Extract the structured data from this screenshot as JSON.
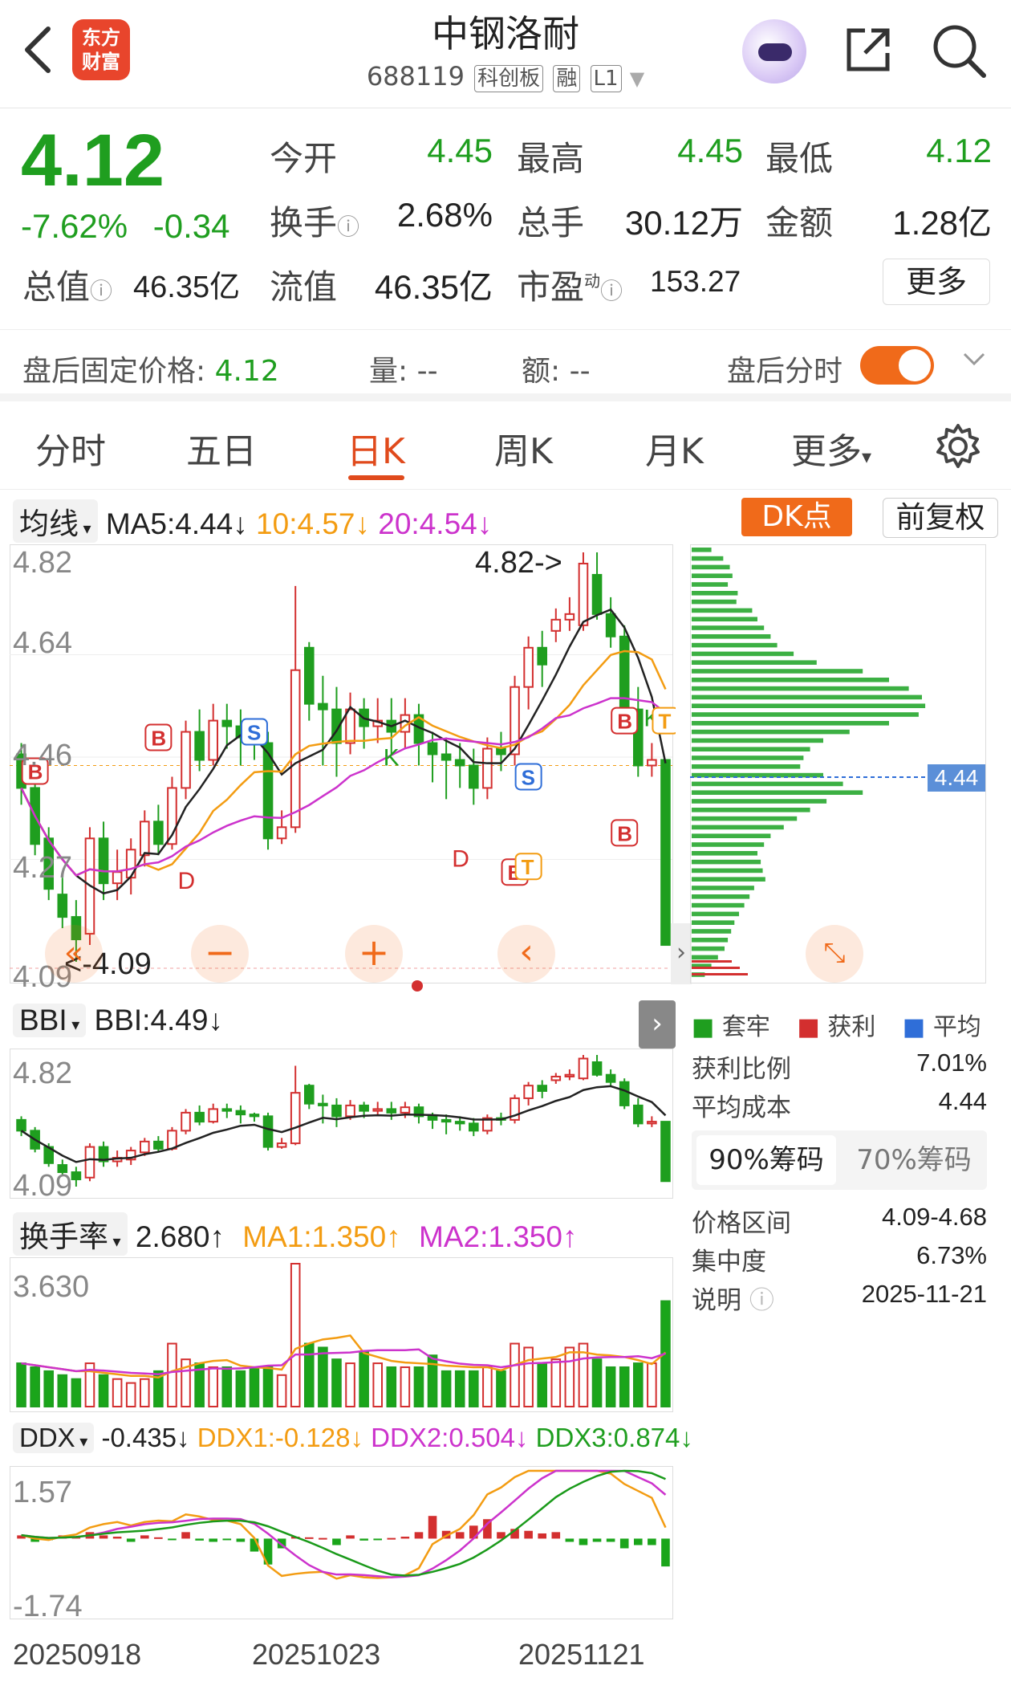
{
  "header": {
    "logo_line1": "东方",
    "logo_line2": "财富",
    "stock_name": "中钢洛耐",
    "stock_code": "688119",
    "tags": [
      "科创板",
      "融",
      "L1"
    ]
  },
  "quote": {
    "price": "4.12",
    "change_pct": "-7.62%",
    "change_abs": "-0.34",
    "open_label": "今开",
    "open": "4.45",
    "high_label": "最高",
    "high": "4.45",
    "low_label": "最低",
    "low": "4.12",
    "turnover_label": "换手",
    "turnover": "2.68%",
    "volume_label": "总手",
    "volume": "30.12万",
    "amount_label": "金额",
    "amount": "1.28亿",
    "total_mv_label": "总值",
    "total_mv": "46.35亿",
    "float_mv_label": "流值",
    "float_mv": "46.35亿",
    "pe_label": "市盈",
    "pe_sup": "动",
    "pe": "153.27",
    "more_label": "更多"
  },
  "after_hours": {
    "fixed_price_label": "盘后固定价格:",
    "fixed_price": "4.12",
    "vol_label": "量:",
    "vol": "--",
    "amt_label": "额:",
    "amt": "--",
    "intraday_label": "盘后分时",
    "toggle_on": true
  },
  "tabs": [
    "分时",
    "五日",
    "日K",
    "周K",
    "月K",
    "更多"
  ],
  "active_tab": "日K",
  "ma_row": {
    "selector": "均线",
    "ma5": "MA5:4.44↓",
    "ma10": "10:4.57↓",
    "ma20": "20:4.54↓",
    "dk_label": "DK点",
    "adj_label": "前复权"
  },
  "main_chart": {
    "y_labels": [
      "4.82",
      "4.64",
      "4.46",
      "4.27",
      "4.09"
    ],
    "max_label": "4.82->",
    "min_label": "<-4.09",
    "markers": [
      "B",
      "B",
      "S",
      "K",
      "D",
      "D",
      "B",
      "B",
      "T",
      "S",
      "B",
      "K",
      "T",
      "B"
    ]
  },
  "chip_panel": {
    "current_price": "4.44",
    "legend": [
      "套牢",
      "获利",
      "平均"
    ],
    "profit_ratio_label": "获利比例",
    "profit_ratio": "7.01%",
    "avg_cost_label": "平均成本",
    "avg_cost": "4.44",
    "tab_90": "90%筹码",
    "tab_70": "70%筹码",
    "range_label": "价格区间",
    "range": "4.09-4.68",
    "concentration_label": "集中度",
    "concentration": "6.73%",
    "note_label": "说明",
    "date": "2025-11-21"
  },
  "bbi": {
    "selector": "BBI",
    "value": "BBI:4.49↓",
    "y_labels": [
      "4.82",
      "4.09"
    ]
  },
  "turnover_ind": {
    "selector": "换手率",
    "value": "2.680↑",
    "ma1": "MA1:1.350↑",
    "ma2": "MA2:1.350↑",
    "y_label": "3.630"
  },
  "ddx": {
    "selector": "DDX",
    "value": "-0.435↓",
    "ddx1": "DDX1:-0.128↓",
    "ddx2": "DDX2:0.504↓",
    "ddx3": "DDX3:0.874↓",
    "y_labels": [
      "1.57",
      "-1.74"
    ]
  },
  "x_axis": [
    "20250918",
    "20251023",
    "20251121"
  ],
  "colors": {
    "up": "#d32f2f",
    "down": "#1f9e1f",
    "ma10": "#f39c12",
    "ma20": "#cc33cc",
    "accent": "#f06a1a"
  },
  "candles": [
    {
      "o": 4.46,
      "c": 4.4,
      "h": 4.48,
      "l": 4.37
    },
    {
      "o": 4.4,
      "c": 4.3,
      "h": 4.42,
      "l": 4.28
    },
    {
      "o": 4.31,
      "c": 4.22,
      "h": 4.33,
      "l": 4.2
    },
    {
      "o": 4.21,
      "c": 4.17,
      "h": 4.24,
      "l": 4.15
    },
    {
      "o": 4.17,
      "c": 4.13,
      "h": 4.2,
      "l": 4.09
    },
    {
      "o": 4.14,
      "c": 4.31,
      "h": 4.33,
      "l": 4.12
    },
    {
      "o": 4.31,
      "c": 4.23,
      "h": 4.34,
      "l": 4.2
    },
    {
      "o": 4.23,
      "c": 4.25,
      "h": 4.29,
      "l": 4.2
    },
    {
      "o": 4.24,
      "c": 4.29,
      "h": 4.31,
      "l": 4.21
    },
    {
      "o": 4.28,
      "c": 4.34,
      "h": 4.36,
      "l": 4.26
    },
    {
      "o": 4.34,
      "c": 4.3,
      "h": 4.37,
      "l": 4.28
    },
    {
      "o": 4.3,
      "c": 4.4,
      "h": 4.42,
      "l": 4.29
    },
    {
      "o": 4.4,
      "c": 4.5,
      "h": 4.52,
      "l": 4.38
    },
    {
      "o": 4.5,
      "c": 4.45,
      "h": 4.54,
      "l": 4.43
    },
    {
      "o": 4.45,
      "c": 4.52,
      "h": 4.55,
      "l": 4.44
    },
    {
      "o": 4.52,
      "c": 4.51,
      "h": 4.55,
      "l": 4.47
    },
    {
      "o": 4.51,
      "c": 4.49,
      "h": 4.54,
      "l": 4.44
    },
    {
      "o": 4.49,
      "c": 4.48,
      "h": 4.5,
      "l": 4.45
    },
    {
      "o": 4.48,
      "c": 4.31,
      "h": 4.5,
      "l": 4.29
    },
    {
      "o": 4.31,
      "c": 4.33,
      "h": 4.36,
      "l": 4.3
    },
    {
      "o": 4.33,
      "c": 4.61,
      "h": 4.76,
      "l": 4.32
    },
    {
      "o": 4.65,
      "c": 4.55,
      "h": 4.66,
      "l": 4.52
    },
    {
      "o": 4.55,
      "c": 4.54,
      "h": 4.6,
      "l": 4.44
    },
    {
      "o": 4.54,
      "c": 4.48,
      "h": 4.58,
      "l": 4.42
    },
    {
      "o": 4.48,
      "c": 4.54,
      "h": 4.57,
      "l": 4.46
    },
    {
      "o": 4.54,
      "c": 4.51,
      "h": 4.56,
      "l": 4.47
    },
    {
      "o": 4.51,
      "c": 4.52,
      "h": 4.56,
      "l": 4.48
    },
    {
      "o": 4.52,
      "c": 4.5,
      "h": 4.56,
      "l": 4.46
    },
    {
      "o": 4.5,
      "c": 4.53,
      "h": 4.56,
      "l": 4.47
    },
    {
      "o": 4.53,
      "c": 4.48,
      "h": 4.55,
      "l": 4.44
    },
    {
      "o": 4.48,
      "c": 4.46,
      "h": 4.5,
      "l": 4.41
    },
    {
      "o": 4.46,
      "c": 4.45,
      "h": 4.49,
      "l": 4.38
    },
    {
      "o": 4.45,
      "c": 4.44,
      "h": 4.48,
      "l": 4.4
    },
    {
      "o": 4.44,
      "c": 4.4,
      "h": 4.47,
      "l": 4.37
    },
    {
      "o": 4.4,
      "c": 4.47,
      "h": 4.49,
      "l": 4.38
    },
    {
      "o": 4.47,
      "c": 4.46,
      "h": 4.5,
      "l": 4.43
    },
    {
      "o": 4.46,
      "c": 4.58,
      "h": 4.6,
      "l": 4.44
    },
    {
      "o": 4.58,
      "c": 4.65,
      "h": 4.67,
      "l": 4.54
    },
    {
      "o": 4.65,
      "c": 4.62,
      "h": 4.68,
      "l": 4.58
    },
    {
      "o": 4.68,
      "c": 4.7,
      "h": 4.72,
      "l": 4.66
    },
    {
      "o": 4.7,
      "c": 4.71,
      "h": 4.74,
      "l": 4.68
    },
    {
      "o": 4.69,
      "c": 4.8,
      "h": 4.82,
      "l": 4.68
    },
    {
      "o": 4.78,
      "c": 4.71,
      "h": 4.82,
      "l": 4.7
    },
    {
      "o": 4.71,
      "c": 4.67,
      "h": 4.74,
      "l": 4.65
    },
    {
      "o": 4.67,
      "c": 4.54,
      "h": 4.69,
      "l": 4.52
    },
    {
      "o": 4.54,
      "c": 4.44,
      "h": 4.58,
      "l": 4.42
    },
    {
      "o": 4.44,
      "c": 4.45,
      "h": 4.48,
      "l": 4.42
    },
    {
      "o": 4.45,
      "c": 4.12,
      "h": 4.45,
      "l": 4.12
    }
  ],
  "turnover_values": [
    1.1,
    1.0,
    0.9,
    0.8,
    0.7,
    1.1,
    0.8,
    0.7,
    0.6,
    0.7,
    0.9,
    1.6,
    1.2,
    1.1,
    1.0,
    1.0,
    0.9,
    1.0,
    1.0,
    0.8,
    3.63,
    1.6,
    1.5,
    1.2,
    1.1,
    1.4,
    1.1,
    1.0,
    1.0,
    1.0,
    1.3,
    0.9,
    0.9,
    0.9,
    1.0,
    0.9,
    1.6,
    1.5,
    1.1,
    1.2,
    1.5,
    1.6,
    1.2,
    1.0,
    1.0,
    1.1,
    1.1,
    2.68
  ],
  "ddx_values": [
    0.05,
    -0.05,
    -0.02,
    0.05,
    0.03,
    0.1,
    0.05,
    0.03,
    -0.05,
    0.05,
    0.02,
    -0.01,
    0.1,
    -0.03,
    -0.05,
    -0.01,
    -0.05,
    -0.2,
    -0.4,
    -0.15,
    0.03,
    0.02,
    0.01,
    -0.1,
    0.05,
    -0.03,
    -0.01,
    0.01,
    0.03,
    0.1,
    0.35,
    0.12,
    0.1,
    0.2,
    0.3,
    0.1,
    0.15,
    0.12,
    0.08,
    0.1,
    -0.05,
    -0.1,
    -0.05,
    -0.05,
    -0.15,
    -0.1,
    -0.1,
    -0.43
  ],
  "chip_bars": [
    30,
    48,
    58,
    62,
    55,
    70,
    68,
    92,
    100,
    110,
    120,
    130,
    155,
    190,
    260,
    300,
    330,
    350,
    355,
    345,
    300,
    240,
    200,
    180,
    170,
    165,
    200,
    230,
    260,
    205,
    180,
    160,
    140,
    120,
    110,
    100,
    105,
    108,
    112,
    95,
    88,
    80,
    72,
    65,
    60,
    55,
    50,
    40,
    30,
    20
  ]
}
